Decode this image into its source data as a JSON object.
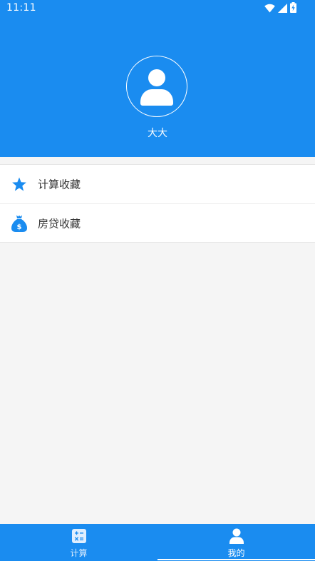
{
  "status_bar": {
    "time": "11:11",
    "icons": [
      "wifi-icon",
      "signal-icon",
      "battery-charging-icon"
    ]
  },
  "profile": {
    "avatar_icon": "user-avatar-icon",
    "username": "大大"
  },
  "menu": {
    "items": [
      {
        "icon": "star-icon",
        "label": "计算收藏"
      },
      {
        "icon": "money-bag-icon",
        "label": "房贷收藏"
      }
    ]
  },
  "bottom_nav": {
    "tabs": [
      {
        "icon": "calculator-icon",
        "label": "计算",
        "active": false
      },
      {
        "icon": "person-icon",
        "label": "我的",
        "active": true
      }
    ]
  },
  "colors": {
    "primary": "#1a8cf0",
    "background": "#f5f5f5",
    "card": "#ffffff",
    "text": "#333333"
  }
}
